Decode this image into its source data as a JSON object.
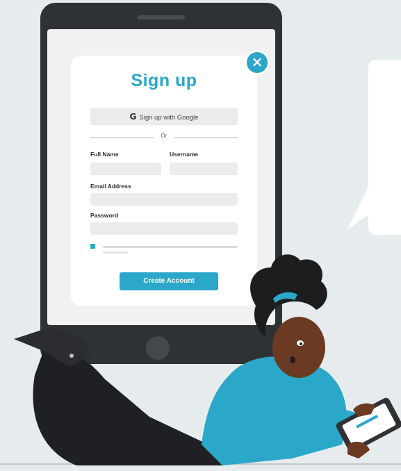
{
  "signup": {
    "title": "Sign up",
    "google_button": "Sign up with Google",
    "google_icon": "G",
    "divider_text": "Or",
    "full_name_label": "Full Name",
    "username_label": "Username",
    "email_label": "Email Address",
    "password_label": "Password",
    "create_button": "Create Account",
    "close_icon": "×"
  },
  "colors": {
    "accent": "#2aa7c9",
    "background": "#e6ecee",
    "tablet": "#2f3235",
    "shirt": "#2aa7c9",
    "skin": "#6b3a22",
    "hair": "#1d1d1f",
    "pants": "#1f2023"
  },
  "icons": {
    "close": "close-icon",
    "google": "google-icon"
  }
}
